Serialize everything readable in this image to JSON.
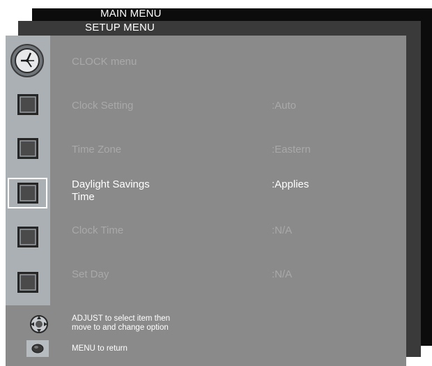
{
  "menus": {
    "main_menu_title": "MAIN MENU",
    "setup_menu_title": "SETUP MENU"
  },
  "clock_menu": {
    "title": "CLOCK menu",
    "items": [
      {
        "label": "Clock Setting",
        "value": ":Auto",
        "selected": false,
        "icon": "square-item-icon"
      },
      {
        "label": "Time Zone",
        "value": ":Eastern",
        "selected": false,
        "icon": "square-item-icon"
      },
      {
        "label": "Daylight Savings",
        "label_line2": "Time",
        "value": ":Applies",
        "selected": true,
        "icon": "square-item-icon"
      },
      {
        "label": "Clock Time",
        "value": ":N/A",
        "selected": false,
        "icon": "square-item-icon"
      },
      {
        "label": "Set Day",
        "value": ":N/A",
        "selected": false,
        "icon": "square-item-icon"
      }
    ]
  },
  "help": {
    "adjust_line1": "ADJUST to select item then",
    "adjust_line2": "move to and change option",
    "menu_hint": "MENU to return",
    "adjust_icon": "adjust-knob-icon",
    "menu_icon": "menu-button-icon"
  },
  "colors": {
    "panel": "#8a8a8a",
    "sidebar": "#aab0b4",
    "text_dim": "#a9a9a9",
    "text_selected": "#ffffff"
  }
}
